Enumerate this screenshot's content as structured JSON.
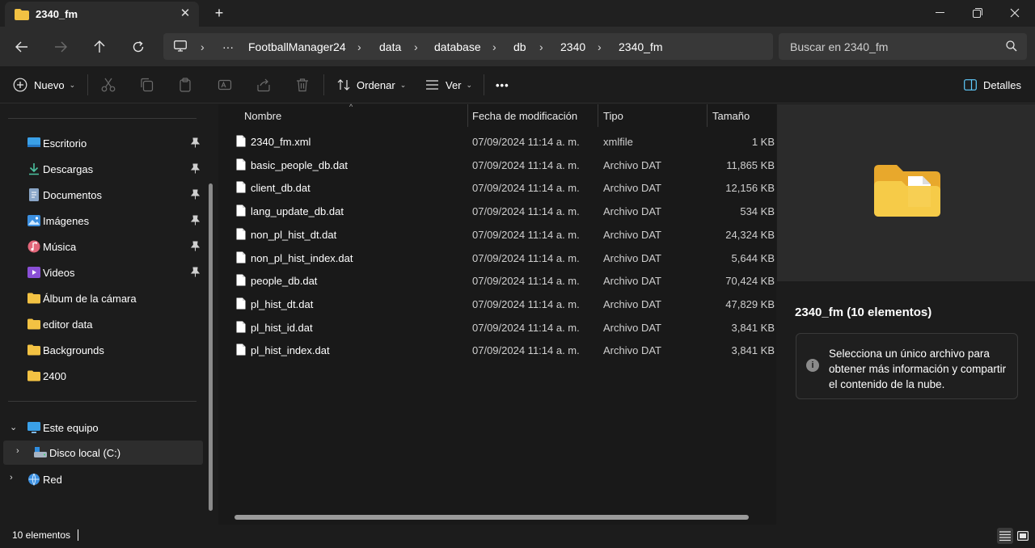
{
  "window": {
    "tab_title": "2340_fm",
    "tab_close_icon": "close-icon",
    "new_tab_icon": "plus-icon",
    "controls": [
      "minimize-icon",
      "restore-icon",
      "close-icon"
    ]
  },
  "nav": {
    "back": "back-arrow-icon",
    "forward": "forward-arrow-icon",
    "up": "up-arrow-icon",
    "refresh": "refresh-icon",
    "breadcrumb": [
      "FootballManager24",
      "data",
      "database",
      "db",
      "2340",
      "2340_fm"
    ],
    "overflow_label": "···",
    "search_placeholder": "Buscar en 2340_fm"
  },
  "toolbar": {
    "new_label": "Nuevo",
    "sort_label": "Ordenar",
    "view_label": "Ver",
    "more_label": "•••",
    "details_label": "Detalles"
  },
  "sidebar": {
    "quick_access": [
      {
        "label": "Escritorio",
        "icon": "desktop-icon",
        "pinned": true
      },
      {
        "label": "Descargas",
        "icon": "download-icon",
        "pinned": true
      },
      {
        "label": "Documentos",
        "icon": "document-icon",
        "pinned": true
      },
      {
        "label": "Imágenes",
        "icon": "image-icon",
        "pinned": true
      },
      {
        "label": "Música",
        "icon": "music-icon",
        "pinned": true
      },
      {
        "label": "Videos",
        "icon": "video-icon",
        "pinned": true
      },
      {
        "label": "Álbum de la cámara",
        "icon": "folder-icon",
        "pinned": false
      },
      {
        "label": "editor data",
        "icon": "folder-icon",
        "pinned": false
      },
      {
        "label": "Backgrounds",
        "icon": "folder-icon",
        "pinned": false
      },
      {
        "label": "2400",
        "icon": "folder-icon",
        "pinned": false
      }
    ],
    "this_pc": "Este equipo",
    "local_disk": "Disco local (C:)",
    "network": "Red"
  },
  "filelist": {
    "columns": [
      "Nombre",
      "Fecha de modificación",
      "Tipo",
      "Tamaño"
    ],
    "rows": [
      {
        "name": "2340_fm.xml",
        "date": "07/09/2024 11:14 a. m.",
        "type": "xmlfile",
        "size": "1 KB"
      },
      {
        "name": "basic_people_db.dat",
        "date": "07/09/2024 11:14 a. m.",
        "type": "Archivo DAT",
        "size": "11,865 KB"
      },
      {
        "name": "client_db.dat",
        "date": "07/09/2024 11:14 a. m.",
        "type": "Archivo DAT",
        "size": "12,156 KB"
      },
      {
        "name": "lang_update_db.dat",
        "date": "07/09/2024 11:14 a. m.",
        "type": "Archivo DAT",
        "size": "534 KB"
      },
      {
        "name": "non_pl_hist_dt.dat",
        "date": "07/09/2024 11:14 a. m.",
        "type": "Archivo DAT",
        "size": "24,324 KB"
      },
      {
        "name": "non_pl_hist_index.dat",
        "date": "07/09/2024 11:14 a. m.",
        "type": "Archivo DAT",
        "size": "5,644 KB"
      },
      {
        "name": "people_db.dat",
        "date": "07/09/2024 11:14 a. m.",
        "type": "Archivo DAT",
        "size": "70,424 KB"
      },
      {
        "name": "pl_hist_dt.dat",
        "date": "07/09/2024 11:14 a. m.",
        "type": "Archivo DAT",
        "size": "47,829 KB"
      },
      {
        "name": "pl_hist_id.dat",
        "date": "07/09/2024 11:14 a. m.",
        "type": "Archivo DAT",
        "size": "3,841 KB"
      },
      {
        "name": "pl_hist_index.dat",
        "date": "07/09/2024 11:14 a. m.",
        "type": "Archivo DAT",
        "size": "3,841 KB"
      }
    ]
  },
  "details": {
    "title": "2340_fm (10 elementos)",
    "info": "Selecciona un único archivo para obtener más información y compartir el contenido de la nube.",
    "info_icon": "i"
  },
  "status": {
    "count": "10 elementos"
  },
  "colors": {
    "accent": "#60cdff",
    "folder": "#f3c243",
    "background": "#1c1c1c"
  }
}
